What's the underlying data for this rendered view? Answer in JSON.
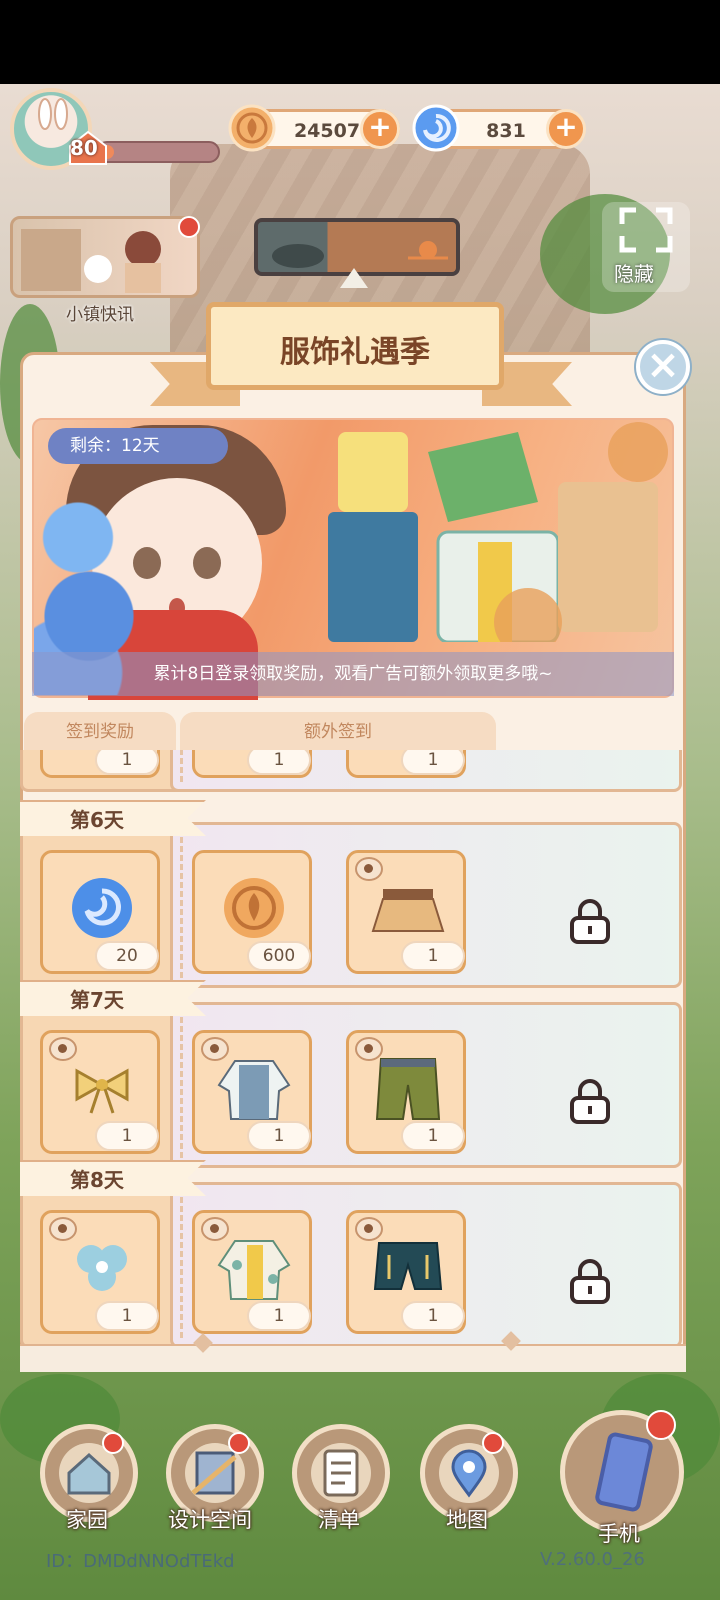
{
  "player": {
    "level": "80",
    "level_progress": 0.05
  },
  "currencies": {
    "coins": "24507",
    "gems": "831"
  },
  "news": {
    "label": "小镇快讯"
  },
  "hide": {
    "label": "隐藏"
  },
  "modal": {
    "title": "服饰礼遇季",
    "remaining": "剩余：12天",
    "caption": "累计8日登录领取奖励，观看广告可额外领取更多哦~",
    "tabs": [
      "签到奖励",
      "额外签到"
    ],
    "partial_row_counts": [
      "1",
      "1",
      "1"
    ],
    "days": [
      {
        "label": "第6天",
        "items": [
          {
            "icon": "blue-swirl-gem-icon",
            "count": "20",
            "ad": false
          },
          {
            "icon": "gold-coin-icon",
            "count": "600",
            "ad": false
          },
          {
            "icon": "skirt-icon",
            "count": "1",
            "ad": true
          }
        ]
      },
      {
        "label": "第7天",
        "items": [
          {
            "icon": "bow-icon",
            "count": "1",
            "ad": true
          },
          {
            "icon": "shirt-vest-icon",
            "count": "1",
            "ad": true
          },
          {
            "icon": "green-pants-icon",
            "count": "1",
            "ad": true
          }
        ]
      },
      {
        "label": "第8天",
        "items": [
          {
            "icon": "flower-hairpin-icon",
            "count": "1",
            "ad": true
          },
          {
            "icon": "floral-shirt-icon",
            "count": "1",
            "ad": true
          },
          {
            "icon": "dark-shorts-icon",
            "count": "1",
            "ad": true
          }
        ]
      }
    ]
  },
  "nav": {
    "home": "家园",
    "design": "设计空间",
    "list": "清单",
    "map": "地图",
    "phone": "手机"
  },
  "footer": {
    "id": "ID：DMDdNNOdTEkd",
    "version": "V.2.60.0_26"
  },
  "colors": {
    "accent": "#f0964e",
    "panel_border": "#e2b793",
    "title": "#7a4527"
  }
}
